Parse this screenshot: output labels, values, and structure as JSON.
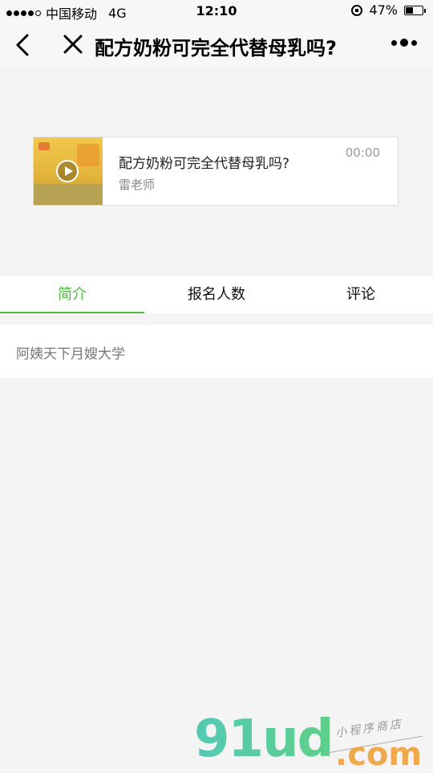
{
  "status_bar": {
    "signal_strength": 4,
    "carrier": "中国移动",
    "network": "4G",
    "time": "12:10",
    "battery_percent": "47%",
    "battery_level": 0.47
  },
  "navbar": {
    "title": "配方奶粉可完全代替母乳吗?",
    "back_icon": "chevron-left-icon",
    "close_icon": "close-icon",
    "more_icon": "more-dots-icon"
  },
  "media_card": {
    "title": "配方奶粉可完全代替母乳吗?",
    "author": "雷老师",
    "duration": "00:00",
    "play_icon": "play-icon"
  },
  "tabs": [
    {
      "label": "简介",
      "active": true
    },
    {
      "label": "报名人数",
      "active": false
    },
    {
      "label": "评论",
      "active": false
    }
  ],
  "intro": {
    "text": "阿姨天下月嫂大学"
  },
  "watermark": {
    "brand": "91ud",
    "domain": ".com",
    "tagline": "小程序商店"
  },
  "colors": {
    "accent": "#4cba3a",
    "background": "#f4f4f4"
  }
}
